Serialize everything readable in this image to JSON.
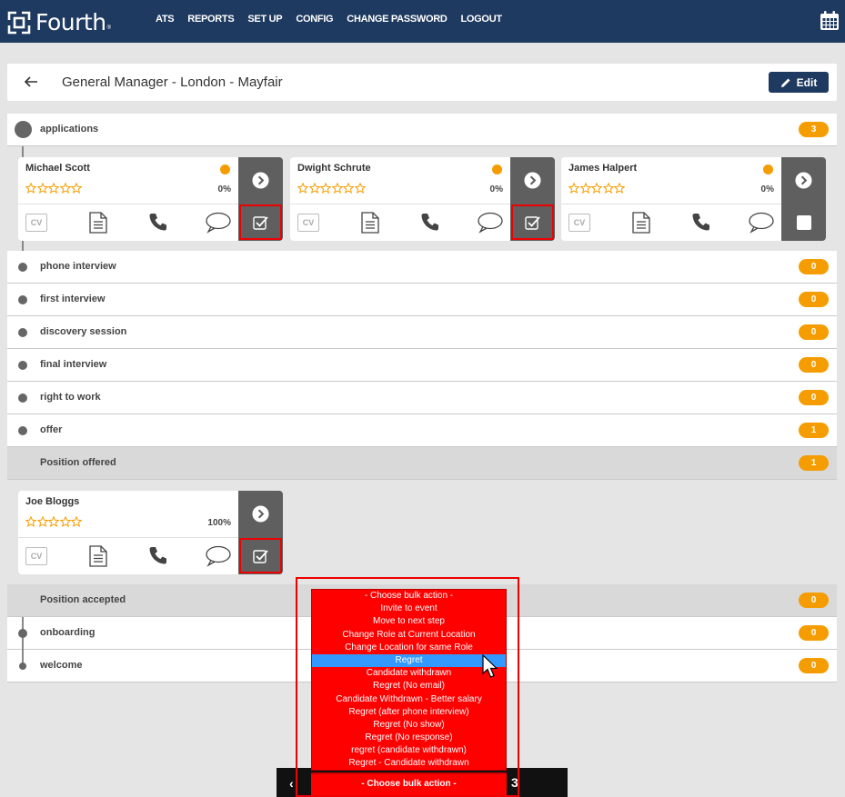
{
  "brand": {
    "name": "Fourth"
  },
  "nav": [
    "ATS",
    "REPORTS",
    "SET UP",
    "CONFIG",
    "CHANGE PASSWORD",
    "LOGOUT"
  ],
  "header": {
    "title": "General Manager - London - Mayfair",
    "edit_label": "Edit"
  },
  "stages": [
    {
      "label": "applications",
      "count": "3"
    },
    {
      "label": "phone interview",
      "count": "0"
    },
    {
      "label": "first interview",
      "count": "0"
    },
    {
      "label": "discovery session",
      "count": "0"
    },
    {
      "label": "final interview",
      "count": "0"
    },
    {
      "label": "right to work",
      "count": "0"
    },
    {
      "label": "offer",
      "count": "1"
    },
    {
      "label": "Position offered",
      "count": "1"
    },
    {
      "label": "Position accepted",
      "count": "0"
    },
    {
      "label": "onboarding",
      "count": "0"
    },
    {
      "label": "welcome",
      "count": "0"
    }
  ],
  "candidates": [
    {
      "name": "Michael Scott",
      "rating": 0,
      "percent": "0%",
      "cv": "CV",
      "selected": true
    },
    {
      "name": "Dwight Schrute",
      "rating": 0,
      "percent": "0%",
      "cv": "CV",
      "selected": true
    },
    {
      "name": "James Halpert",
      "rating": 0,
      "percent": "0%",
      "cv": "CV",
      "selected": false
    },
    {
      "name": "Joe Bloggs",
      "rating": 0,
      "percent": "100%",
      "cv": "CV",
      "selected": true
    }
  ],
  "bulk_actions": {
    "options": [
      "- Choose bulk action -",
      "Invite to event",
      "Move to next step",
      "Change Role at Current Location",
      "Change Location for same Role",
      "Regret",
      "Candidate withdrawn",
      "Regret (No email)",
      "Candidate Withdrawn - Better salary",
      "Regret (after phone interview)",
      "Regret (No show)",
      "Regret (No response)",
      "regret (candidate withdrawn)",
      "Regret - Candidate withdrawn"
    ],
    "highlighted": "Regret",
    "selected": "- Choose bulk action -"
  },
  "bottom_bar": {
    "left": "‹",
    "right": "3"
  },
  "colors": {
    "navy": "#1f3a60",
    "orange": "#f59d00",
    "red": "#ff0000",
    "highlight": "#3399ff"
  }
}
